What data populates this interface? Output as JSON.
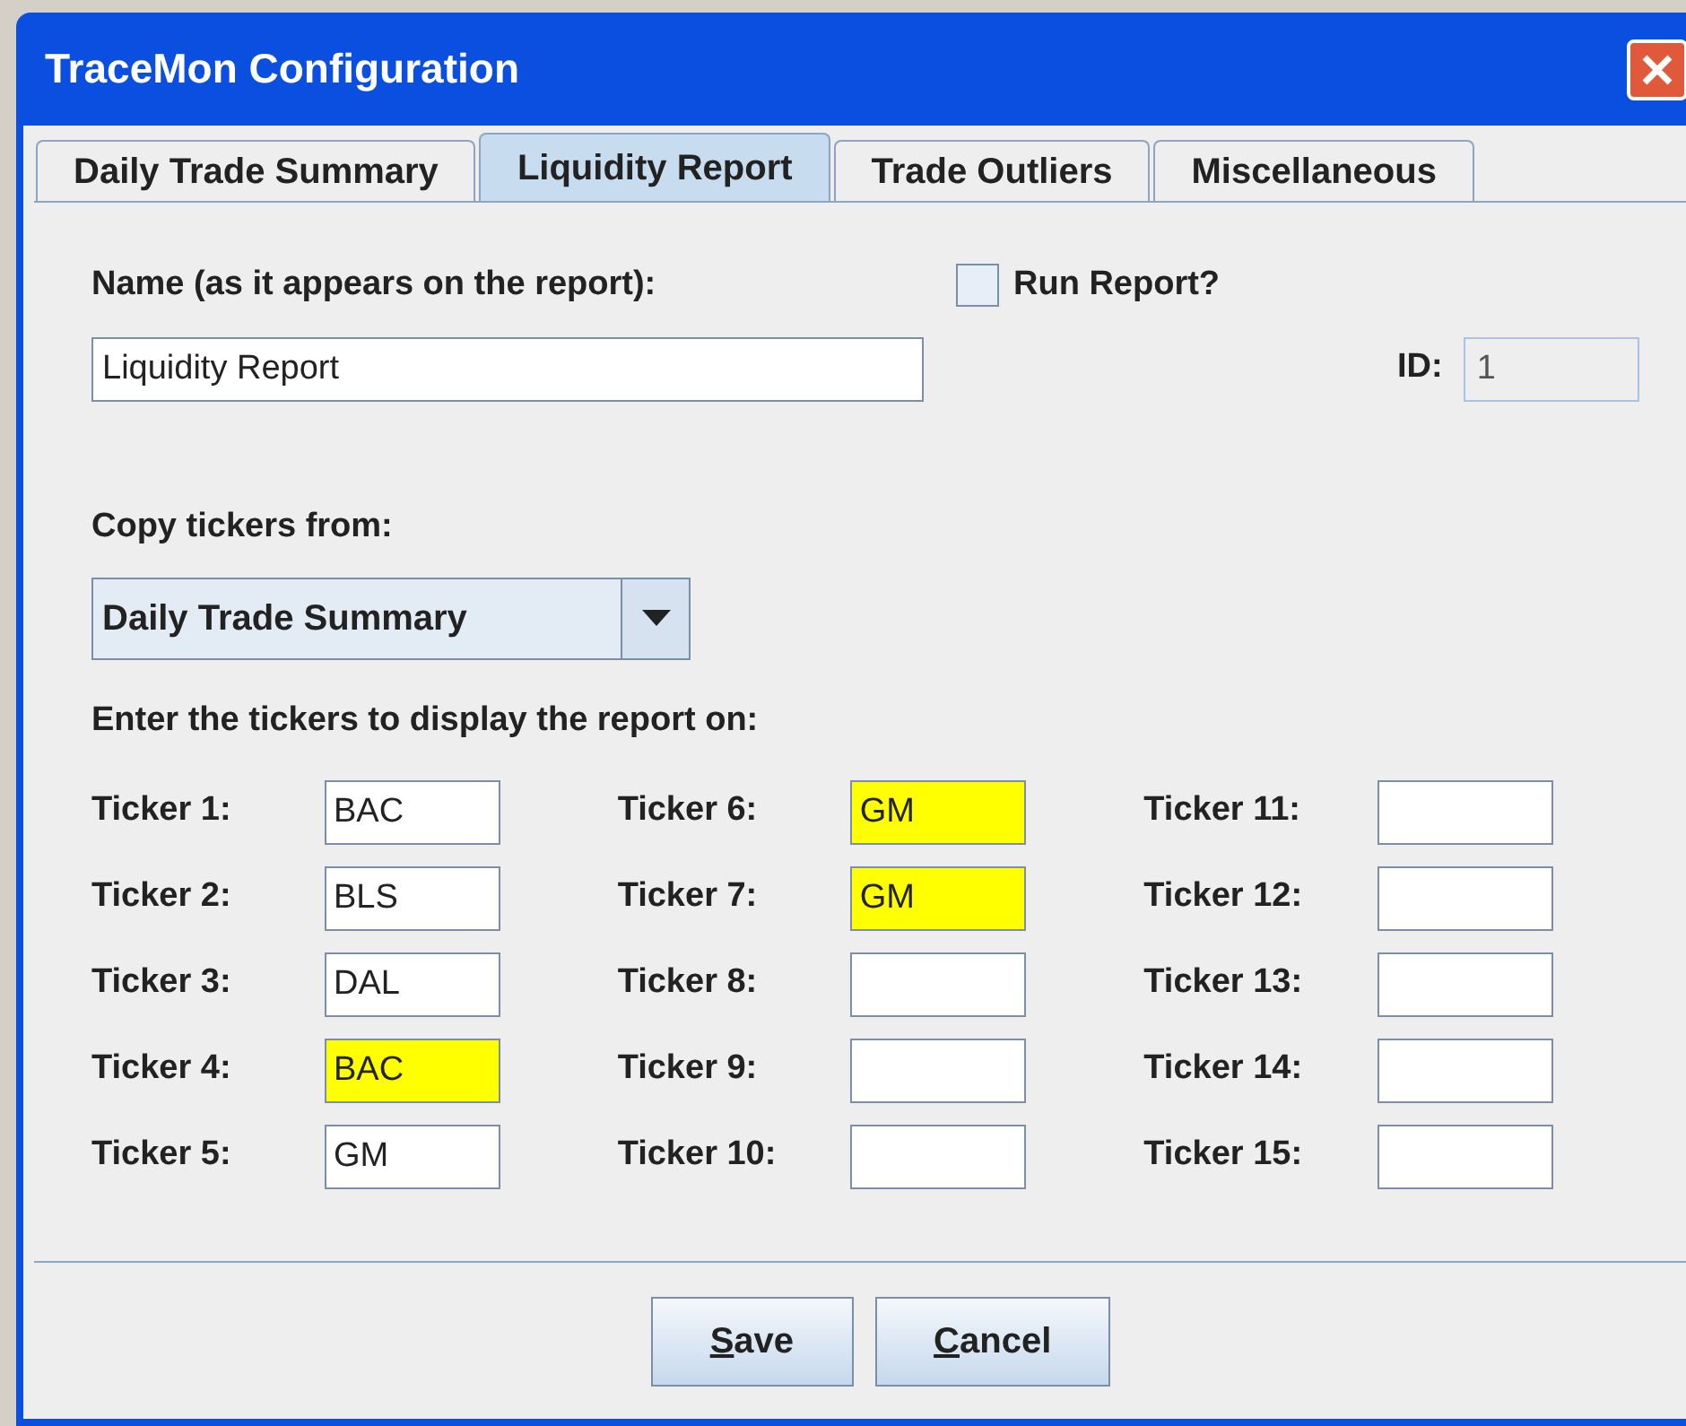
{
  "window": {
    "title": "TraceMon Configuration"
  },
  "tabs": [
    {
      "label": "Daily Trade Summary",
      "selected": false
    },
    {
      "label": "Liquidity Report",
      "selected": true
    },
    {
      "label": "Trade Outliers",
      "selected": false
    },
    {
      "label": "Miscellaneous",
      "selected": false
    }
  ],
  "name_field": {
    "label": "Name (as it appears on the report):",
    "value": "Liquidity Report"
  },
  "run_report": {
    "label": "Run Report?",
    "checked": false
  },
  "id_field": {
    "label": "ID:",
    "value": "1",
    "disabled": true
  },
  "copy_from": {
    "label": "Copy tickers from:",
    "value": "Daily Trade Summary"
  },
  "tickers_heading": "Enter the tickers to display the report on:",
  "tickers": [
    {
      "label": "Ticker 1:",
      "value": "BAC",
      "highlighted": false
    },
    {
      "label": "Ticker 2:",
      "value": "BLS",
      "highlighted": false
    },
    {
      "label": "Ticker 3:",
      "value": "DAL",
      "highlighted": false
    },
    {
      "label": "Ticker 4:",
      "value": "BAC",
      "highlighted": true
    },
    {
      "label": "Ticker 5:",
      "value": "GM",
      "highlighted": false
    },
    {
      "label": "Ticker 6:",
      "value": "GM",
      "highlighted": true
    },
    {
      "label": "Ticker 7:",
      "value": "GM",
      "highlighted": true
    },
    {
      "label": "Ticker 8:",
      "highlighted": false
    },
    {
      "label": "Ticker 9:",
      "highlighted": false
    },
    {
      "label": "Ticker 10:",
      "highlighted": false
    },
    {
      "label": "Ticker 11:",
      "highlighted": false
    },
    {
      "label": "Ticker 12:",
      "highlighted": false
    },
    {
      "label": "Ticker 13:",
      "highlighted": false
    },
    {
      "label": "Ticker 14:",
      "highlighted": false
    },
    {
      "label": "Ticker 15:",
      "highlighted": false
    }
  ],
  "buttons": [
    {
      "label": "Save",
      "mnemonic": true
    },
    {
      "label": "Cancel",
      "mnemonic": true
    }
  ]
}
